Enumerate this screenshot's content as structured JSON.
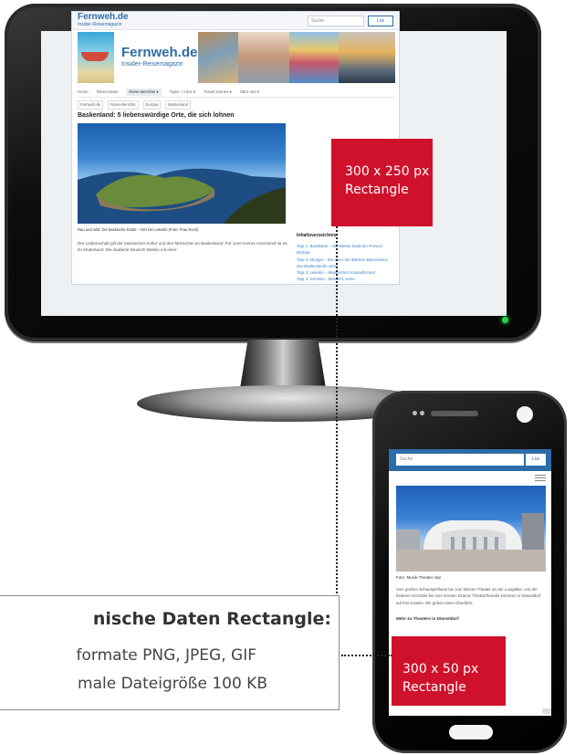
{
  "desktop_site": {
    "logo_small": "Fernweh.de",
    "logo_small_sub": "Insider-Reisemagazin",
    "search_placeholder": "Suche",
    "search_button": "Los",
    "logo": "Fernweh.de",
    "logo_sub": "Insider-Reisemagazin",
    "nav": [
      {
        "label": "Home",
        "active": false
      },
      {
        "label": "Reise-News",
        "active": false
      },
      {
        "label": "Reise-Berichte ▾",
        "active": true
      },
      {
        "label": "Tipps + Infos ▾",
        "active": false
      },
      {
        "label": "Travel-Stories ▾",
        "active": false
      },
      {
        "label": "Über uns ▾",
        "active": false
      }
    ],
    "breadcrumbs": [
      "Fernweh.de",
      "Reise-Berichte",
      "Europa",
      "Baskenland"
    ],
    "article_title": "Baskenland: 5 liebenswürdige Orte, die sich lohnen",
    "article_caption": "Rau und wild: Die baskische Küste – hier bei Lekeitio (Foto: Frau Koch)",
    "article_text": "Der Leidenschaft gilt der baskischen Kultur und den Menschen im Baskenland. Für Jone Karres Azurmendi ist es ihr Mutterland: Die studierte Deutsch Baskin mit einer",
    "toc_title": "Inhaltsverzeichnis",
    "toc_items": [
      "Tipp 1: Barakaldo – die älteste Stadt der Provinz Bizkaia",
      "Tipp 2: Mungia – Wo einer der ältesten Baumriesen des Baskenlands steht",
      "Tipp 3: Lekeitio – Malerischer Küstenfischort",
      "Tipp 4: Gernika – Bekannt, seine"
    ]
  },
  "ads": {
    "desktop_size": "300 x 250 px",
    "desktop_label": "Rectangle",
    "mobile_size": "300 x 50 px",
    "mobile_label": "Rectangle",
    "color": "#d0112b"
  },
  "spec": {
    "title": "nische Daten Rectangle:",
    "line1": "formate PNG, JPEG, GIF",
    "line2": "male Dateigröße 100 KB"
  },
  "mobile_site": {
    "search_placeholder": "Suche",
    "search_button": "Los",
    "photo_caption": "Foto: Musik-Theater Akp",
    "text": "Vom großen Schauspielhaus bis zum kleinen Theater an der Luegallee, von der heiteren Komödie bis zum ernsten Drama: Theaterfreunde kommen in Düsseldorf auf ihre Kosten. Wir geben einen Überblick.",
    "more": "Mehr zu Theatern in Düsseldorf",
    "header_color": "#2c6ca8"
  }
}
